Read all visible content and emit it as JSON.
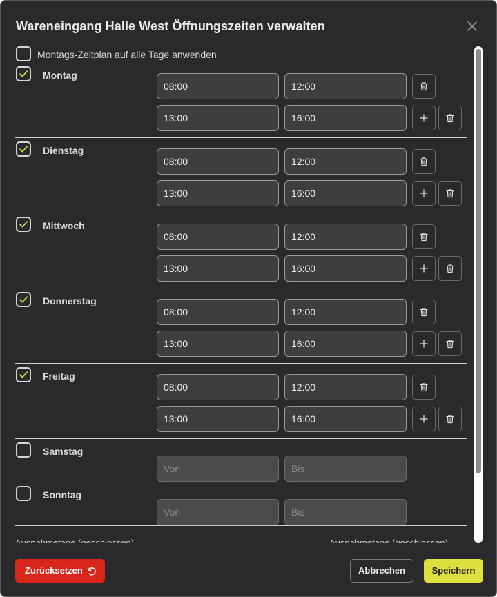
{
  "dialog": {
    "title": "Wareneingang Halle West Öffnungszeiten verwalten",
    "close_icon": "close-icon"
  },
  "apply_all": {
    "label": "Montags-Zeitplan auf alle Tage anwenden",
    "checked": false
  },
  "days": [
    {
      "name": "Montag",
      "checked": true,
      "slots": [
        {
          "from": "08:00",
          "to": "12:00"
        },
        {
          "from": "13:00",
          "to": "16:00"
        }
      ]
    },
    {
      "name": "Dienstag",
      "checked": true,
      "slots": [
        {
          "from": "08:00",
          "to": "12:00"
        },
        {
          "from": "13:00",
          "to": "16:00"
        }
      ]
    },
    {
      "name": "Mittwoch",
      "checked": true,
      "slots": [
        {
          "from": "08:00",
          "to": "12:00"
        },
        {
          "from": "13:00",
          "to": "16:00"
        }
      ]
    },
    {
      "name": "Donnerstag",
      "checked": true,
      "slots": [
        {
          "from": "08:00",
          "to": "12:00"
        },
        {
          "from": "13:00",
          "to": "16:00"
        }
      ]
    },
    {
      "name": "Freitag",
      "checked": true,
      "slots": [
        {
          "from": "08:00",
          "to": "12:00"
        },
        {
          "from": "13:00",
          "to": "16:00"
        }
      ]
    },
    {
      "name": "Samstag",
      "checked": false,
      "slots": [
        {
          "from": "",
          "to": ""
        }
      ]
    },
    {
      "name": "Sonntag",
      "checked": false,
      "slots": [
        {
          "from": "",
          "to": ""
        }
      ]
    }
  ],
  "placeholders": {
    "from": "Von",
    "to": "Bis"
  },
  "clipped": {
    "left_text": "Ausnahmetage (geschlossen)",
    "right_text": "Ausnahmetage (geschlossen)"
  },
  "footer": {
    "reset_label": "Zurücksetzen",
    "reset_icon": "rotate-ccw-icon",
    "cancel_label": "Abbrechen",
    "save_label": "Speichern"
  },
  "colors": {
    "background": "#2a2a2c",
    "danger": "#d9261c",
    "accent": "#dde03f",
    "check": "#d9dd3a"
  }
}
